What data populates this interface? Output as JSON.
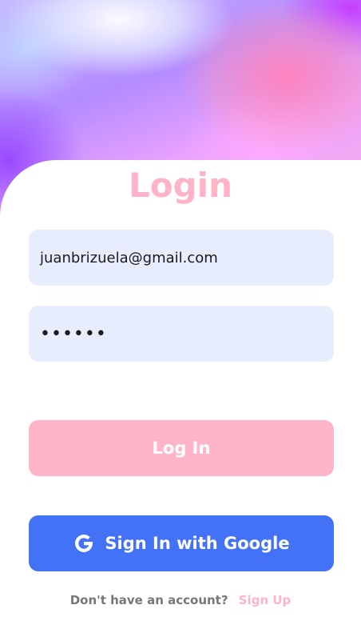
{
  "login": {
    "title": "Login",
    "email_value": "juanbrizuela@gmail.com",
    "password_value": "••••••",
    "login_button": "Log In",
    "google_button": "Sign In with Google",
    "footer_question": "Don't have an account?",
    "footer_link": "Sign Up"
  },
  "colors": {
    "title": "#ffb3c7",
    "field_bg": "#e8edfe",
    "login_button_bg": "#ffb5c8",
    "google_button_bg": "#4472f6",
    "footer_link": "#ffb3c7",
    "footer_text": "#777777"
  },
  "icons": {
    "google": "google-g-icon"
  }
}
